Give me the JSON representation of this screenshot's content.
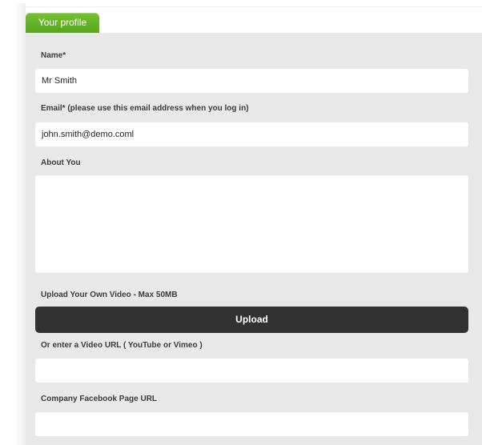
{
  "tab": {
    "label": "Your profile"
  },
  "form": {
    "name": {
      "label": "Name*",
      "value": "Mr Smith"
    },
    "email": {
      "label": "Email* (please use this email address when you log in)",
      "value": "john.smith@demo.coml"
    },
    "about": {
      "label": "About You",
      "value": ""
    },
    "upload": {
      "label": "Upload Your Own Video - Max 50MB",
      "button_label": "Upload"
    },
    "video_url": {
      "label": "Or enter a Video URL ( YouTube or Vimeo )",
      "value": ""
    },
    "facebook_url": {
      "label": "Company Facebook Page URL",
      "value": ""
    }
  },
  "colors": {
    "tab_accent": "#64b428",
    "panel_bg": "#e8e8e8",
    "button_bg": "#323232"
  }
}
